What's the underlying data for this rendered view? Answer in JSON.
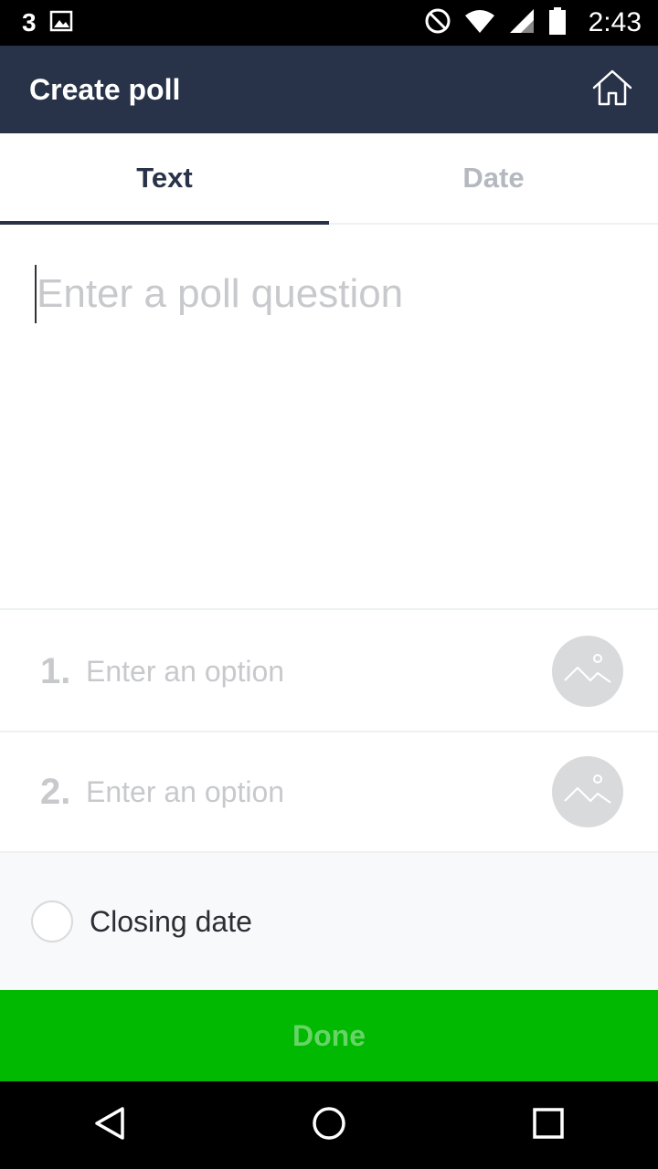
{
  "status_bar": {
    "notification_count": "3",
    "time": "2:43",
    "icons": [
      "image-icon",
      "do-not-disturb-icon",
      "wifi-icon",
      "signal-icon",
      "battery-icon"
    ]
  },
  "app_bar": {
    "title": "Create poll",
    "home_icon": "home-icon"
  },
  "tabs": [
    {
      "label": "Text",
      "active": true
    },
    {
      "label": "Date",
      "active": false
    }
  ],
  "question": {
    "placeholder": "Enter a poll question",
    "value": ""
  },
  "options": [
    {
      "number": "1.",
      "placeholder": "Enter an option",
      "value": "",
      "icon": "image-icon"
    },
    {
      "number": "2.",
      "placeholder": "Enter an option",
      "value": "",
      "icon": "image-icon"
    }
  ],
  "closing_date": {
    "label": "Closing date",
    "checked": false
  },
  "done": {
    "label": "Done"
  },
  "nav_bar": {
    "icons": [
      "back-icon",
      "home-circle-icon",
      "recents-icon"
    ]
  },
  "colors": {
    "app_bar": "#283248",
    "accent_green": "#00b900",
    "placeholder": "#c8c9cc",
    "inactive_tab": "#b4b8bf"
  }
}
